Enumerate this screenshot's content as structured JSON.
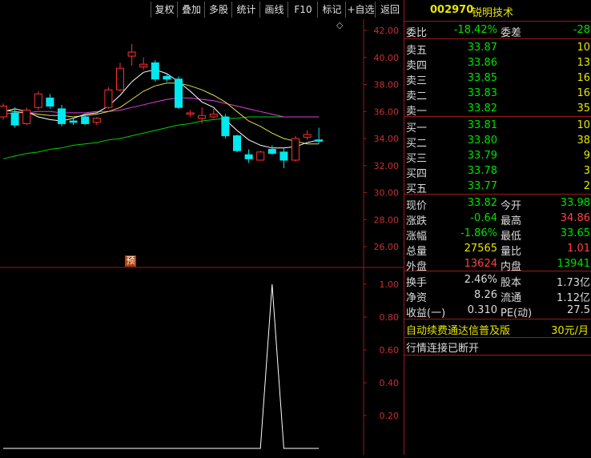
{
  "toolbar": [
    {
      "id": "fuquan",
      "label": "复权"
    },
    {
      "id": "diejia",
      "label": "叠加"
    },
    {
      "id": "duogu",
      "label": "多股"
    },
    {
      "id": "tongji",
      "label": "统计"
    },
    {
      "id": "huaxian",
      "label": "画线"
    },
    {
      "id": "f10",
      "label": "F10"
    },
    {
      "id": "biaoji",
      "label": "标记"
    },
    {
      "id": "zixuan",
      "label": "+自选"
    },
    {
      "id": "fanhui",
      "label": "返回"
    }
  ],
  "stock": {
    "code": "002970",
    "name": "锐明技术"
  },
  "main_axis_labels": [
    "42.00",
    "40.00",
    "38.00",
    "36.00",
    "34.00",
    "32.00",
    "30.00",
    "28.00",
    "26.00"
  ],
  "sub_axis_labels": [
    "1.00",
    "0.80",
    "0.60",
    "0.40",
    "0.20"
  ],
  "yu_marker": "预",
  "diamond": "◇",
  "weibi": {
    "label": "委比",
    "value": "-18.42%",
    "label2": "委差",
    "value2": "-28"
  },
  "sells": [
    {
      "label": "卖五",
      "price": "33.87",
      "vol": "10"
    },
    {
      "label": "卖四",
      "price": "33.86",
      "vol": "13"
    },
    {
      "label": "卖三",
      "price": "33.85",
      "vol": "16"
    },
    {
      "label": "卖二",
      "price": "33.83",
      "vol": "16"
    },
    {
      "label": "卖一",
      "price": "33.82",
      "vol": "35"
    }
  ],
  "buys": [
    {
      "label": "买一",
      "price": "33.81",
      "vol": "10"
    },
    {
      "label": "买二",
      "price": "33.80",
      "vol": "38"
    },
    {
      "label": "买三",
      "price": "33.79",
      "vol": "9"
    },
    {
      "label": "买四",
      "price": "33.78",
      "vol": "3"
    },
    {
      "label": "买五",
      "price": "33.77",
      "vol": "2"
    }
  ],
  "quote": [
    {
      "l1": "现价",
      "v1": "33.82",
      "c1": "#00e000",
      "l2": "今开",
      "v2": "33.98",
      "c2": "#00e000"
    },
    {
      "l1": "涨跌",
      "v1": "-0.64",
      "c1": "#00e000",
      "l2": "最高",
      "v2": "34.86",
      "c2": "#ff4040"
    },
    {
      "l1": "涨幅",
      "v1": "-1.86%",
      "c1": "#00e000",
      "l2": "最低",
      "v2": "33.65",
      "c2": "#00e000"
    },
    {
      "l1": "总量",
      "v1": "27565",
      "c1": "#e6e600",
      "l2": "量比",
      "v2": "1.01",
      "c2": "#ff4040"
    },
    {
      "l1": "外盘",
      "v1": "13624",
      "c1": "#ff4040",
      "l2": "内盘",
      "v2": "13941",
      "c2": "#00e000"
    }
  ],
  "fundamentals": [
    {
      "l1": "换手",
      "v1": "2.46%",
      "l2": "股本",
      "v2": "1.73亿"
    },
    {
      "l1": "净资",
      "v1": "8.26",
      "l2": "流通",
      "v2": "1.12亿"
    },
    {
      "l1": "收益(一)",
      "v1": "0.310",
      "l2": "PE(动)",
      "v2": "27.5"
    }
  ],
  "ad": {
    "text": "自动续费通达信普及版",
    "price": "30元/月"
  },
  "status": "行情连接已断开",
  "colors": {
    "up": "#ff3030",
    "down": "#00e8f0",
    "ma5": "#ffffff",
    "ma10": "#e0e040",
    "ma20": "#e040e0",
    "ma60": "#00d000",
    "border": "#9a1a1a"
  },
  "chart_data": {
    "type": "candlestick",
    "ylim": [
      25,
      43
    ],
    "candles": [
      {
        "o": 35.6,
        "h": 36.6,
        "l": 35.4,
        "c": 36.4
      },
      {
        "o": 35.9,
        "h": 36.3,
        "l": 34.8,
        "c": 35.0
      },
      {
        "o": 35.1,
        "h": 36.3,
        "l": 35.0,
        "c": 36.1
      },
      {
        "o": 36.3,
        "h": 37.5,
        "l": 36.1,
        "c": 37.3
      },
      {
        "o": 37.0,
        "h": 37.3,
        "l": 36.2,
        "c": 36.4
      },
      {
        "o": 36.2,
        "h": 36.5,
        "l": 34.9,
        "c": 35.1
      },
      {
        "o": 35.3,
        "h": 35.5,
        "l": 35.0,
        "c": 35.2
      },
      {
        "o": 35.6,
        "h": 35.8,
        "l": 35.0,
        "c": 35.1
      },
      {
        "o": 35.2,
        "h": 35.6,
        "l": 35.0,
        "c": 35.5
      },
      {
        "o": 36.3,
        "h": 37.8,
        "l": 36.2,
        "c": 37.6
      },
      {
        "o": 37.6,
        "h": 39.6,
        "l": 37.5,
        "c": 39.2
      },
      {
        "o": 40.1,
        "h": 41.0,
        "l": 39.4,
        "c": 40.4
      },
      {
        "o": 39.3,
        "h": 40.0,
        "l": 39.1,
        "c": 39.5
      },
      {
        "o": 39.6,
        "h": 39.8,
        "l": 38.2,
        "c": 38.4
      },
      {
        "o": 38.6,
        "h": 38.8,
        "l": 38.2,
        "c": 38.4
      },
      {
        "o": 38.4,
        "h": 38.6,
        "l": 36.2,
        "c": 36.3
      },
      {
        "o": 35.8,
        "h": 36.1,
        "l": 35.6,
        "c": 35.9
      },
      {
        "o": 35.5,
        "h": 36.3,
        "l": 35.1,
        "c": 35.7
      },
      {
        "o": 35.6,
        "h": 36.2,
        "l": 35.5,
        "c": 35.8
      },
      {
        "o": 35.6,
        "h": 35.8,
        "l": 34.0,
        "c": 34.2
      },
      {
        "o": 34.2,
        "h": 34.3,
        "l": 33.0,
        "c": 33.1
      },
      {
        "o": 32.8,
        "h": 33.2,
        "l": 32.2,
        "c": 32.5
      },
      {
        "o": 32.4,
        "h": 33.1,
        "l": 32.4,
        "c": 33.0
      },
      {
        "o": 33.2,
        "h": 33.5,
        "l": 32.8,
        "c": 32.9
      },
      {
        "o": 33.0,
        "h": 33.3,
        "l": 31.8,
        "c": 32.4
      },
      {
        "o": 32.4,
        "h": 34.2,
        "l": 32.3,
        "c": 34.0
      },
      {
        "o": 34.1,
        "h": 34.6,
        "l": 33.9,
        "c": 34.3
      },
      {
        "o": 33.9,
        "h": 34.8,
        "l": 33.6,
        "c": 33.8
      }
    ],
    "ma5": [
      36.0,
      36.2,
      36.0,
      35.6,
      35.4,
      35.3,
      35.5,
      35.8,
      35.9,
      36.4,
      37.2,
      38.2,
      38.9,
      39.1,
      38.8,
      38.2,
      37.5,
      36.7,
      36.3,
      35.4,
      34.6,
      33.9,
      33.5,
      33.3,
      33.3,
      33.4,
      33.7,
      33.9
    ],
    "ma10": [
      36.1,
      36.0,
      35.9,
      35.8,
      35.7,
      35.7,
      35.6,
      35.7,
      35.8,
      36.0,
      36.3,
      36.9,
      37.5,
      37.9,
      38.1,
      38.1,
      37.9,
      37.6,
      37.2,
      36.7,
      36.0,
      35.3,
      34.9,
      34.4,
      34.0,
      33.8,
      33.6,
      33.6
    ],
    "ma20": [
      35.8,
      35.9,
      35.9,
      36.0,
      36.0,
      35.9,
      35.9,
      35.9,
      36.0,
      36.0,
      36.1,
      36.3,
      36.5,
      36.7,
      36.9,
      37.0,
      37.0,
      36.9,
      36.8,
      36.6,
      36.4,
      36.2,
      36.0,
      35.8,
      35.6,
      35.6,
      35.6,
      35.6
    ],
    "ma60": [
      32.5,
      32.7,
      32.9,
      33.0,
      33.2,
      33.3,
      33.5,
      33.6,
      33.7,
      33.9,
      34.0,
      34.2,
      34.4,
      34.6,
      34.8,
      35.0,
      35.1,
      35.3,
      35.4,
      35.5,
      35.5,
      35.6,
      35.6,
      35.6,
      35.6,
      35.6,
      35.6,
      35.6
    ],
    "sub": {
      "ylim": [
        0,
        1.1
      ],
      "values": [
        0,
        0,
        0,
        0,
        0,
        0,
        0,
        0,
        0,
        0,
        0,
        0,
        0,
        0,
        0,
        0,
        0,
        0,
        0,
        0,
        0,
        0,
        0,
        1,
        0,
        0,
        0,
        0
      ]
    }
  }
}
